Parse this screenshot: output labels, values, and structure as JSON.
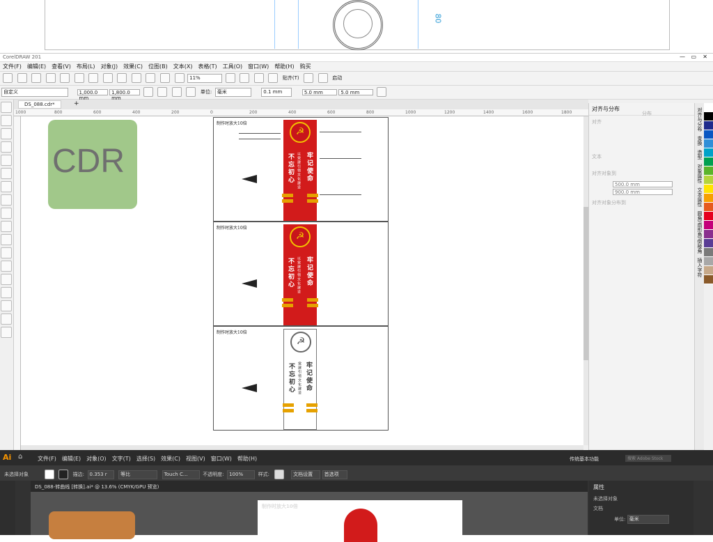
{
  "preview": {
    "dimension_label": "80"
  },
  "corel": {
    "title": "CorelDRAW 201",
    "menu": [
      "文件(F)",
      "编辑(E)",
      "查看(V)",
      "布局(L)",
      "对象(J)",
      "效果(C)",
      "位图(B)",
      "文本(X)",
      "表格(T)",
      "工具(O)",
      "窗口(W)",
      "帮助(H)",
      "购买"
    ],
    "toolbar": {
      "zoom": "11%",
      "paste_to": "贴齐(T)",
      "launch": "启动"
    },
    "propbar": {
      "preset": "自定义",
      "width": "1,000.0 mm",
      "height": "1,800.0 mm",
      "unit_label": "单位:",
      "unit": "毫米",
      "nudge": "0.1 mm",
      "dup_x": "5.0 mm",
      "dup_y": "5.0 mm"
    },
    "doc_tab": "DS_088.cdr*",
    "ruler_ticks": [
      "1000",
      "800",
      "600",
      "400",
      "200",
      "0",
      "200",
      "400",
      "600",
      "800",
      "1000",
      "1200",
      "1400",
      "1600",
      "1800"
    ],
    "cdr_badge": "CDR",
    "boards": [
      {
        "caption": "制作时放大10倍",
        "left_text": "不忘初心",
        "right_text": "牢记使命",
        "mid_text": "以党建引领文化建设"
      },
      {
        "caption": "制作时放大10倍",
        "left_text": "不忘初心",
        "right_text": "牢记使命",
        "mid_text": "以党建引领文化建设"
      },
      {
        "caption": "制作时放大10倍",
        "left_text": "不忘初心",
        "right_text": "牢记使命",
        "mid_text": "党建引领文化建设"
      }
    ],
    "panel": {
      "title": "对齐与分布",
      "section_align": "对齐",
      "section_distribute": "分布",
      "section_text": "文本",
      "section_spacing": "对齐对象到",
      "field1": "500.0 mm",
      "field2": "900.0 mm",
      "section_dist_by": "对齐对象分布到"
    },
    "dock_tabs": [
      "对齐与分布",
      "变换",
      "造型",
      "对象属性",
      "文本属性",
      "圆角/扇形角/倒棱角",
      "插入字符"
    ],
    "palette": [
      "#ffffff",
      "#000000",
      "#1e2b8c",
      "#0a57c2",
      "#2f8fd8",
      "#00a2c8",
      "#00a050",
      "#5bb42b",
      "#b5d43c",
      "#ffe400",
      "#f7a100",
      "#e65a1e",
      "#e5001e",
      "#c4007a",
      "#8a2f8f",
      "#5a3d95",
      "#7a7a7a",
      "#a8a8a8",
      "#c6a98a",
      "#8a5a2a"
    ]
  },
  "ai": {
    "logo": "Ai",
    "menu": [
      "文件(F)",
      "编辑(E)",
      "对象(O)",
      "文字(T)",
      "选择(S)",
      "效果(C)",
      "视图(V)",
      "窗口(W)",
      "帮助(H)"
    ],
    "workspace": "传统基本功能",
    "search_placeholder": "搜索 Adobe Stock",
    "control": {
      "no_selection": "未选择对象",
      "stroke_label": "描边:",
      "stroke_value": "0.353 r",
      "stroke_style": "等比",
      "brush": "Touch C...",
      "opacity_label": "不透明度:",
      "opacity": "100%",
      "style_label": "样式:",
      "doc_setup": "文档设置",
      "prefs": "首选项"
    },
    "doc_tab": "DS_088-转曲线 [转换].ai* @ 13.6% (CMYK/GPU 预览)",
    "artboard_caption": "制作时放大10倍",
    "props": {
      "title": "属性",
      "no_selection": "未选择对象",
      "doc": "文档",
      "unit_label": "单位:",
      "unit": "毫米"
    }
  }
}
